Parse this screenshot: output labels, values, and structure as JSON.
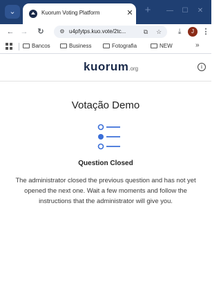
{
  "browser": {
    "tab": {
      "title": "Kuorum Voting Platform"
    },
    "toolbar": {
      "url": "u4pfytps.kuo.vote/2tc...",
      "profile_initial": "J"
    },
    "bookmarks": [
      "Bancos",
      "Business",
      "Fotografia",
      "NEW"
    ]
  },
  "header": {
    "logo_text": "kuorum",
    "logo_suffix": ".org"
  },
  "main": {
    "title": "Votação Demo",
    "status_heading": "Question Closed",
    "status_message": "The administrator closed the previous question and has not yet opened the next one. Wait a few moments and follow the instructions that the administrator will give you."
  },
  "colors": {
    "tabstrip": "#1f3f72",
    "accent": "#3b6fd8",
    "logo": "#1a2a4a"
  }
}
